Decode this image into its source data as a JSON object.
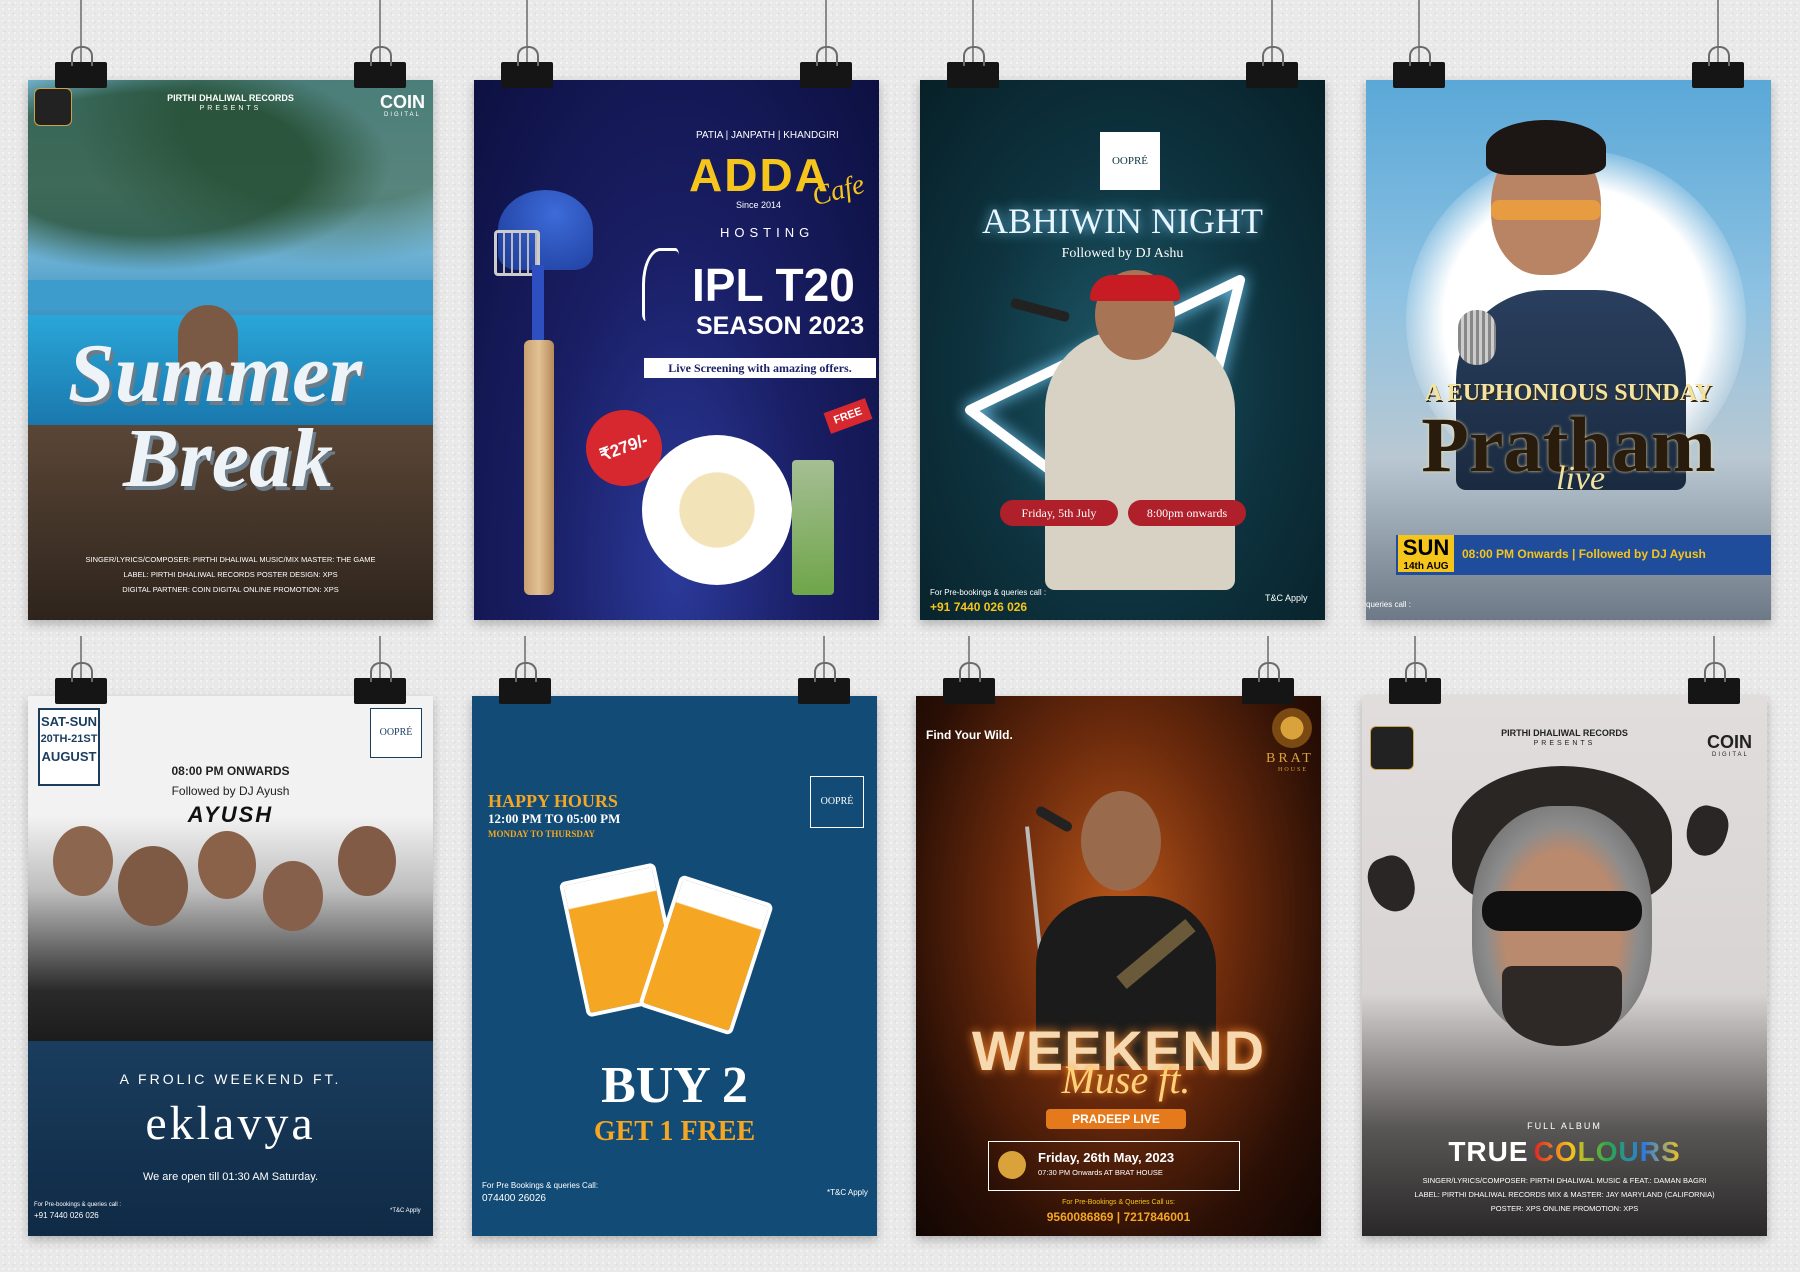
{
  "posters": {
    "summer_break": {
      "label_records": "PIRTHI DHALIWAL RECORDS",
      "presents": "PRESENTS",
      "coin": "COIN",
      "coin_sub": "DIGITAL",
      "title1": "Summer",
      "title2": "Break",
      "credit1": "SINGER/LYRICS/COMPOSER: PIRTHI DHALIWAL    MUSIC/MIX MASTER: THE GAME",
      "credit2": "LABEL: PIRTHI DHALIWAL RECORDS    POSTER DESIGN: XPS",
      "credit3": "DIGITAL PARTNER: COIN DIGITAL    ONLINE PROMOTION: XPS"
    },
    "adda": {
      "locations": "PATIA | JANPATH | KHANDGIRI",
      "brand": "ADDA",
      "cafe": "Cafe",
      "since": "Since 2014",
      "hosting": "HOSTING",
      "ipl": "IPL T20",
      "season": "SEASON 2023",
      "banner": "Live Screening with amazing offers.",
      "price": "₹279/-",
      "free": "FREE"
    },
    "abhiwin": {
      "logo": "OOPRÉ",
      "title": "ABHIWIN NIGHT",
      "subtitle": "Followed by DJ Ashu",
      "date": "Friday, 5th July",
      "time": "8:00pm onwards",
      "booking_label": "For Pre-bookings & queries call :",
      "phone": "+91 7440 026 026",
      "tc": "T&C Apply"
    },
    "pratham": {
      "kicker": "A EUPHONIOUS SUNDAY",
      "title": "Pratham",
      "live": "live",
      "day": "SUN",
      "date": "14th AUG",
      "details": "08:00 PM Onwards | Followed by DJ Ayush",
      "queries": "queries call :"
    },
    "eklavya": {
      "days": "SAT-SUN",
      "dates": "20TH-21ST",
      "month": "AUGUST",
      "logo": "OOPRÉ",
      "time": "08:00 PM ONWARDS",
      "followed": "Followed by DJ Ayush",
      "dj": "AYUSH",
      "frolic": "A FROLIC WEEKEND FT.",
      "band": "eklavya",
      "open": "We are open till 01:30 AM Saturday.",
      "booking_label": "For Pre-bookings & queries call :",
      "phone": "+91 7440 026 026",
      "tc": "*T&C Apply"
    },
    "happy_hours": {
      "title": "HAPPY HOURS",
      "time": "12:00 PM TO 05:00 PM",
      "days": "MONDAY TO THURSDAY",
      "logo": "OOPRÉ",
      "buy": "BUY 2",
      "get": "GET 1 FREE",
      "booking_label": "For Pre Bookings & queries Call:",
      "phone": "074400 26026",
      "tc": "*T&C Apply"
    },
    "weekend_muse": {
      "tagline": "Find Your Wild.",
      "brand": "BRAT",
      "brand_sub": "HOUSE",
      "title": "WEEKEND",
      "muse": "Muse ft.",
      "artist": "PRADEEP LIVE",
      "date": "Friday, 26th May, 2023",
      "time": "07:30 PM Onwards AT BRAT HOUSE",
      "booking_label": "For Pre-Bookings & Queries Call us:",
      "phones": "9560086869 | 7217846001"
    },
    "true_colours": {
      "label_records": "PIRTHI DHALIWAL RECORDS",
      "presents": "PRESENTS",
      "coin": "COIN",
      "coin_sub": "DIGITAL",
      "full_album": "FULL ALBUM",
      "true": "TRUE",
      "colours": "COLOURS",
      "credit1": "SINGER/LYRICS/COMPOSER: PIRTHI DHALIWAL    MUSIC & FEAT.: DAMAN BAGRI",
      "credit2": "LABEL: PIRTHI DHALIWAL RECORDS    MIX & MASTER: JAY MARYLAND (CALIFORNIA)",
      "credit3": "POSTER: XPS    ONLINE PROMOTION: XPS"
    }
  }
}
